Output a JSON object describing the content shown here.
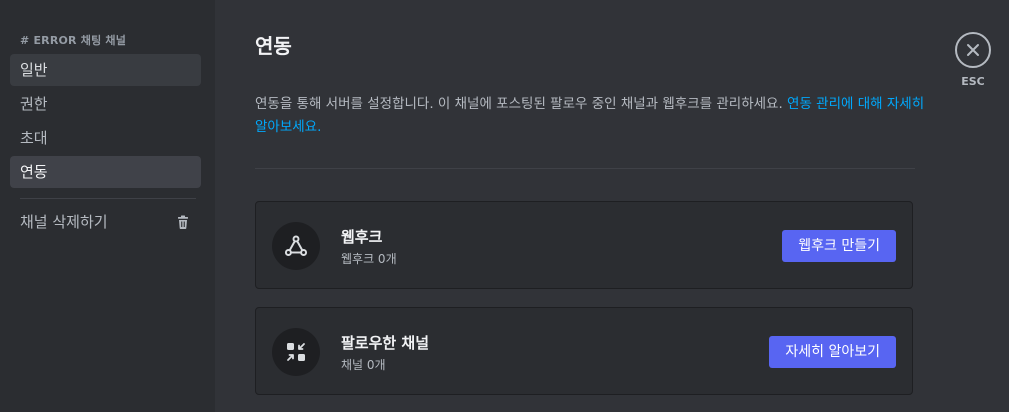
{
  "sidebar": {
    "header_hash": "#",
    "header_channel": "ERROR",
    "header_suffix": "채팅 채널",
    "items": [
      {
        "label": "일반"
      },
      {
        "label": "권한"
      },
      {
        "label": "초대"
      },
      {
        "label": "연동"
      }
    ],
    "delete_label": "채널 삭제하기"
  },
  "main": {
    "title": "연동",
    "description": "연동을 통해 서버를 설정합니다. 이 채널에 포스팅된 팔로우 중인 채널과 웹후크를 관리하세요.",
    "description_link": "연동 관리에 대해 자세히 알아보세요.",
    "cards": [
      {
        "title": "웹후크",
        "subtitle": "웹후크 0개",
        "button": "웹후크 만들기",
        "icon": "webhook-icon"
      },
      {
        "title": "팔로우한 채널",
        "subtitle": "채널 0개",
        "button": "자세히 알아보기",
        "icon": "follow-channel-icon"
      }
    ]
  },
  "close": {
    "label": "ESC"
  },
  "colors": {
    "accent": "#5865f2",
    "link": "#00a8fc",
    "sidebar_bg": "#2b2d31",
    "main_bg": "#313338"
  }
}
